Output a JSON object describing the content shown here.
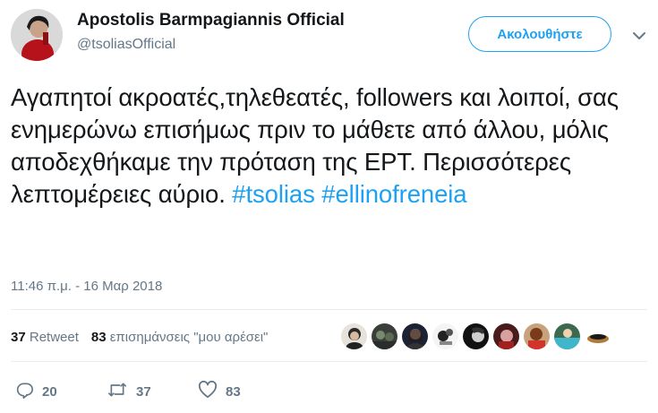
{
  "author": {
    "name": "Apostolis Barmpagiannis Official",
    "handle": "@tsoliasOfficial"
  },
  "follow_button_label": "Ακολουθήστε",
  "tweet": {
    "text_main": "Αγαπητοί ακροατές,τηλεθεατές, followers και λοιποί, σας ενημερώνω επισήμως πριν το μάθετε από άλλου, μόλις αποδεχθήκαμε την πρόταση της ΕΡΤ.  Περισσότερες λεπτομέρειες αύριο.",
    "hashtags": [
      "#tsolias",
      "#ellinofreneia"
    ]
  },
  "timestamp": "11:46 π.μ. - 16 Μαρ 2018",
  "stats": {
    "retweets_count": "37",
    "retweets_label": "Retweet",
    "likes_count": "83",
    "likes_label": "επισημάνσεις \"μου αρέσει\""
  },
  "actions": {
    "replies": "20",
    "retweets": "37",
    "likes": "83"
  },
  "icons": [
    "chevron-down-icon",
    "reply-icon",
    "retweet-icon",
    "like-icon"
  ],
  "colors": {
    "accent": "#1da1f2",
    "text": "#14171a",
    "muted": "#657786",
    "divider": "#e6ecf0"
  }
}
